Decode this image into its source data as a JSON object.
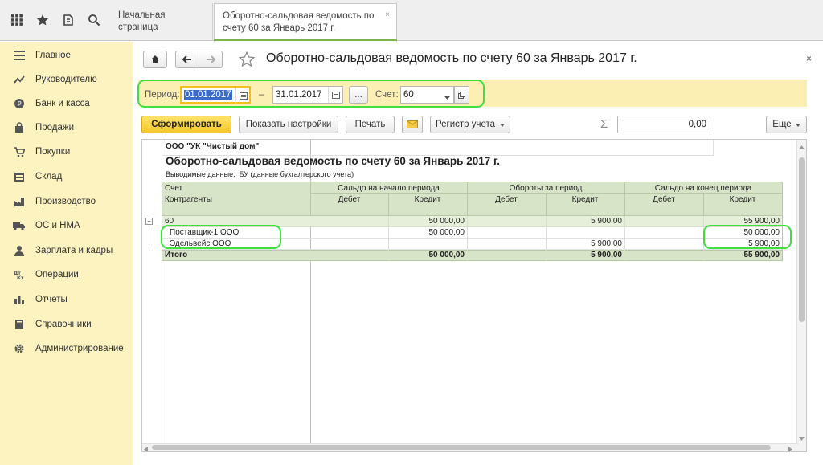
{
  "topbar": {
    "icons": [
      "apps-grid-icon",
      "star-icon",
      "history-icon",
      "search-icon"
    ],
    "tabs": [
      {
        "label": "Начальная страница"
      },
      {
        "label": "Оборотно-сальдовая ведомость по счету 60 за Январь 2017 г."
      }
    ],
    "close_glyph": "×"
  },
  "sidebar": {
    "items": [
      {
        "label": "Главное",
        "icon": "menu-icon"
      },
      {
        "label": "Руководителю",
        "icon": "chart-line-icon"
      },
      {
        "label": "Банк и касса",
        "icon": "coin-icon"
      },
      {
        "label": "Продажи",
        "icon": "bag-icon"
      },
      {
        "label": "Покупки",
        "icon": "cart-icon"
      },
      {
        "label": "Склад",
        "icon": "warehouse-icon"
      },
      {
        "label": "Производство",
        "icon": "factory-icon"
      },
      {
        "label": "ОС и НМА",
        "icon": "truck-icon"
      },
      {
        "label": "Зарплата и кадры",
        "icon": "person-icon"
      },
      {
        "label": "Операции",
        "icon": "dt-kt-icon"
      },
      {
        "label": "Отчеты",
        "icon": "bar-chart-icon"
      },
      {
        "label": "Справочники",
        "icon": "book-icon"
      },
      {
        "label": "Администрирование",
        "icon": "gear-icon"
      }
    ]
  },
  "form": {
    "title": "Оборотно-сальдовая ведомость по счету 60 за Январь 2017 г.",
    "close_glyph": "×",
    "period_label": "Период:",
    "date_from": "01.01.2017",
    "dash": "–",
    "date_to": "31.01.2017",
    "ellipsis": "...",
    "account_label": "Счет:",
    "account_value": "60",
    "buttons": {
      "generate": "Сформировать",
      "show_settings": "Показать настройки",
      "print": "Печать",
      "register": "Регистр учета",
      "more": "Еще"
    },
    "sum_symbol": "Σ",
    "sum_value": "0,00"
  },
  "report": {
    "org": "ООО \"УК \"Чистый дом\"",
    "title": "Оборотно-сальдовая ведомость по счету 60 за Январь 2017 г.",
    "output_label": "Выводимые данные:",
    "output_value": "БУ (данные бухгалтерского учета)",
    "headers": {
      "account": "Счет",
      "counterparties": "Контрагенты",
      "opening": "Сальдо на начало периода",
      "turnover": "Обороты за период",
      "closing": "Сальдо на конец периода",
      "debit": "Дебет",
      "credit": "Кредит"
    },
    "rows": [
      {
        "name": "60",
        "open_cr": "50 000,00",
        "turn_cr": "5 900,00",
        "close_cr": "55 900,00"
      },
      {
        "name": "Поставщик-1 ООО",
        "open_cr": "50 000,00",
        "turn_cr": "",
        "close_cr": "50 000,00"
      },
      {
        "name": "Эдельвейс ООО",
        "open_cr": "",
        "turn_cr": "5 900,00",
        "close_cr": "5 900,00"
      }
    ],
    "total": {
      "name": "Итого",
      "open_cr": "50 000,00",
      "turn_cr": "5 900,00",
      "close_cr": "55 900,00"
    },
    "tree_toggle": "−"
  }
}
